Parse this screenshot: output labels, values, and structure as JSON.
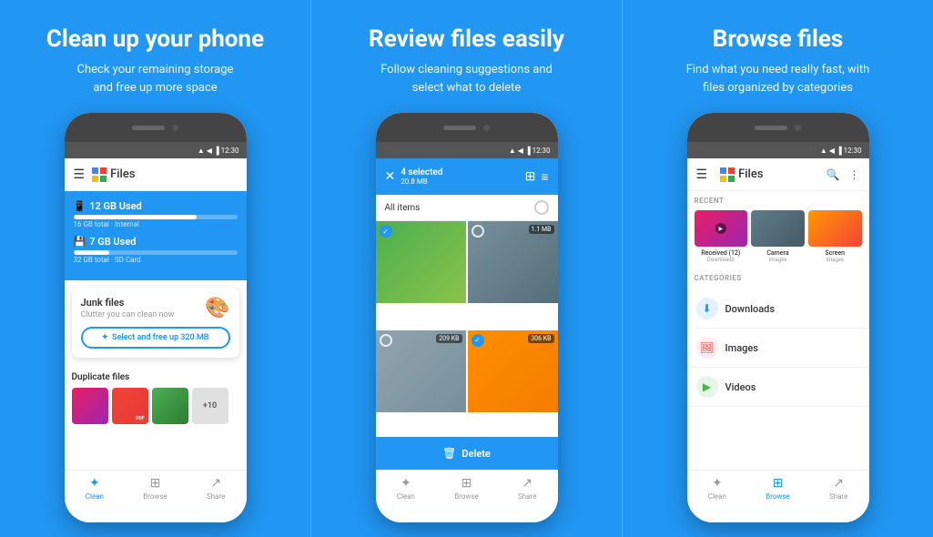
{
  "panel1": {
    "title": "Clean up your phone",
    "subtitle": "Check your remaining storage\nand free up more space",
    "appName": "Files",
    "storage": [
      {
        "label": "12 GB Used",
        "sublabel": "16 GB total · Internal",
        "fillPct": 75,
        "icon": "📱"
      },
      {
        "label": "7 GB Used",
        "sublabel": "32 GB total · SD Card",
        "fillPct": 22,
        "icon": "💾"
      }
    ],
    "junkCard": {
      "title": "Junk files",
      "subtitle": "Clutter you can clean now",
      "buttonLabel": "Select and free up 320 MB"
    },
    "duplicateSection": {
      "title": "Duplicate files"
    },
    "nav": [
      {
        "label": "Clean",
        "active": true
      },
      {
        "label": "Browse",
        "active": false
      },
      {
        "label": "Share",
        "active": false
      }
    ]
  },
  "panel2": {
    "title": "Review files easily",
    "subtitle": "Follow cleaning suggestions and\nselect what to delete",
    "appBar": {
      "selected": "4 selected",
      "size": "20.8 MB"
    },
    "allItems": "All items",
    "cells": [
      {
        "color": "green",
        "size": "",
        "checked": true,
        "type": "top-left"
      },
      {
        "color": "cliff",
        "size": "1.1 MB",
        "checked": false,
        "type": "top-right"
      },
      {
        "color": "mountain",
        "size": "209 KB",
        "checked": false,
        "type": "bottom-left"
      },
      {
        "color": "sunset",
        "size": "",
        "checked": true,
        "type": "bottom-right"
      }
    ],
    "deleteButton": "Delete",
    "nav": [
      {
        "label": "Clean",
        "active": false
      },
      {
        "label": "Browse",
        "active": false
      },
      {
        "label": "Share",
        "active": false
      }
    ]
  },
  "panel3": {
    "title": "Browse files",
    "subtitle": "Find what you need really fast, with\nfiles organized by categories",
    "appName": "Files",
    "recent": {
      "sectionLabel": "RECENT",
      "items": [
        {
          "name": "Received (12)",
          "type": "Downloads"
        },
        {
          "name": "Camera",
          "type": "Images"
        },
        {
          "name": "Screen",
          "type": "Images"
        }
      ]
    },
    "categories": {
      "sectionLabel": "CATEGORIES",
      "items": [
        {
          "name": "Downloads",
          "iconColor": "blue"
        },
        {
          "name": "Images",
          "iconColor": "red"
        },
        {
          "name": "Videos",
          "iconColor": "green"
        }
      ]
    },
    "nav": [
      {
        "label": "Clean",
        "active": false
      },
      {
        "label": "Browse",
        "active": true
      },
      {
        "label": "Share",
        "active": false
      }
    ]
  },
  "colors": {
    "blue": "#2196F3",
    "white": "#ffffff",
    "textDark": "#333333",
    "textLight": "#999999"
  }
}
